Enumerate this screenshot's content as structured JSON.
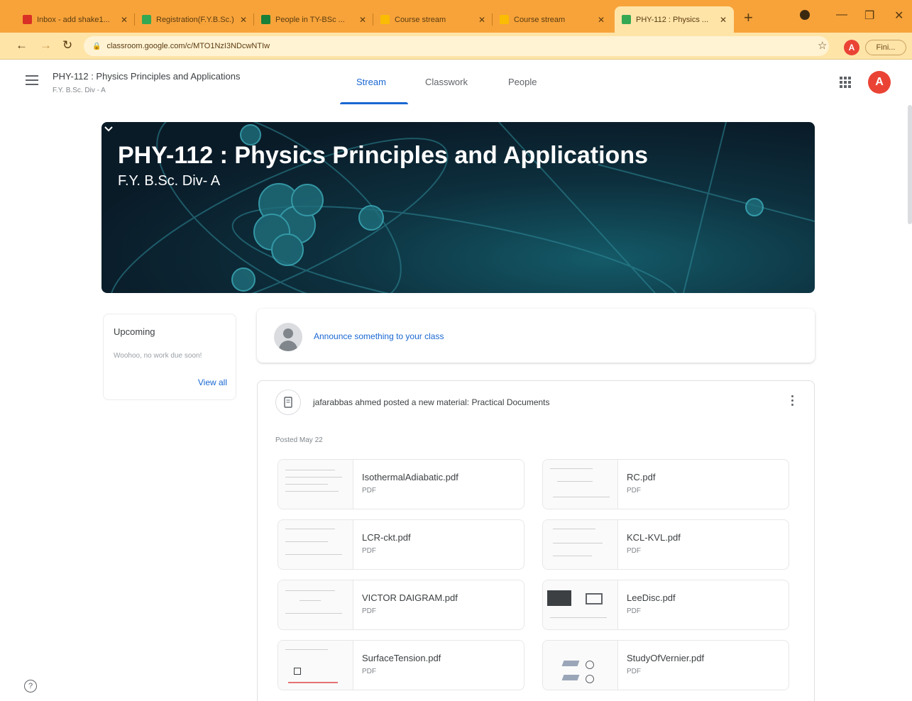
{
  "browser": {
    "tabs": [
      {
        "title": "Inbox - add shake1...",
        "color": "#d93025"
      },
      {
        "title": "Registration(F.Y.B.Sc.)",
        "color": "#34a853"
      },
      {
        "title": "People in TY-BSc ...",
        "color": "#188038"
      },
      {
        "title": "Course stream",
        "color": "#fbbc04"
      },
      {
        "title": "Course stream",
        "color": "#fbbc04"
      },
      {
        "title": "PHY-112 : Physics ...",
        "color": "#34a853"
      }
    ],
    "url": "classroom.google.com/c/MTO1NzI3NDcwNTIw",
    "profile_initial": "A",
    "finish_label": "Fini..."
  },
  "header": {
    "course_name": "PHY-112 : Physics Principles and Applications",
    "course_section": "F.Y. B.Sc. Div - A",
    "tabs": [
      "Stream",
      "Classwork",
      "People"
    ],
    "active_tab": "Stream",
    "user_initial": "A"
  },
  "banner": {
    "title": "PHY-112 : Physics Principles and Applications",
    "subtitle": "F.Y. B.Sc. Div- A"
  },
  "upcoming": {
    "title": "Upcoming",
    "empty_text": "Woohoo, no work due soon!",
    "view_all": "View all"
  },
  "announce": {
    "placeholder": "Announce something to your class"
  },
  "post": {
    "title": "jafarabbas ahmed posted a new material: Practical Documents",
    "date": "Posted May 22",
    "attachments": [
      {
        "name": "IsothermalAdiabatic.pdf",
        "kind": "PDF"
      },
      {
        "name": "RC.pdf",
        "kind": "PDF"
      },
      {
        "name": "LCR-ckt.pdf",
        "kind": "PDF"
      },
      {
        "name": "KCL-KVL.pdf",
        "kind": "PDF"
      },
      {
        "name": "VICTOR DAIGRAM.pdf",
        "kind": "PDF"
      },
      {
        "name": "LeeDisc.pdf",
        "kind": "PDF"
      },
      {
        "name": "SurfaceTension.pdf",
        "kind": "PDF"
      },
      {
        "name": "StudyOfVernier.pdf",
        "kind": "PDF"
      }
    ]
  },
  "colors": {
    "browser_frame": "#f7a33a",
    "accent": "#1967d2",
    "avatar": "#ea4335"
  }
}
